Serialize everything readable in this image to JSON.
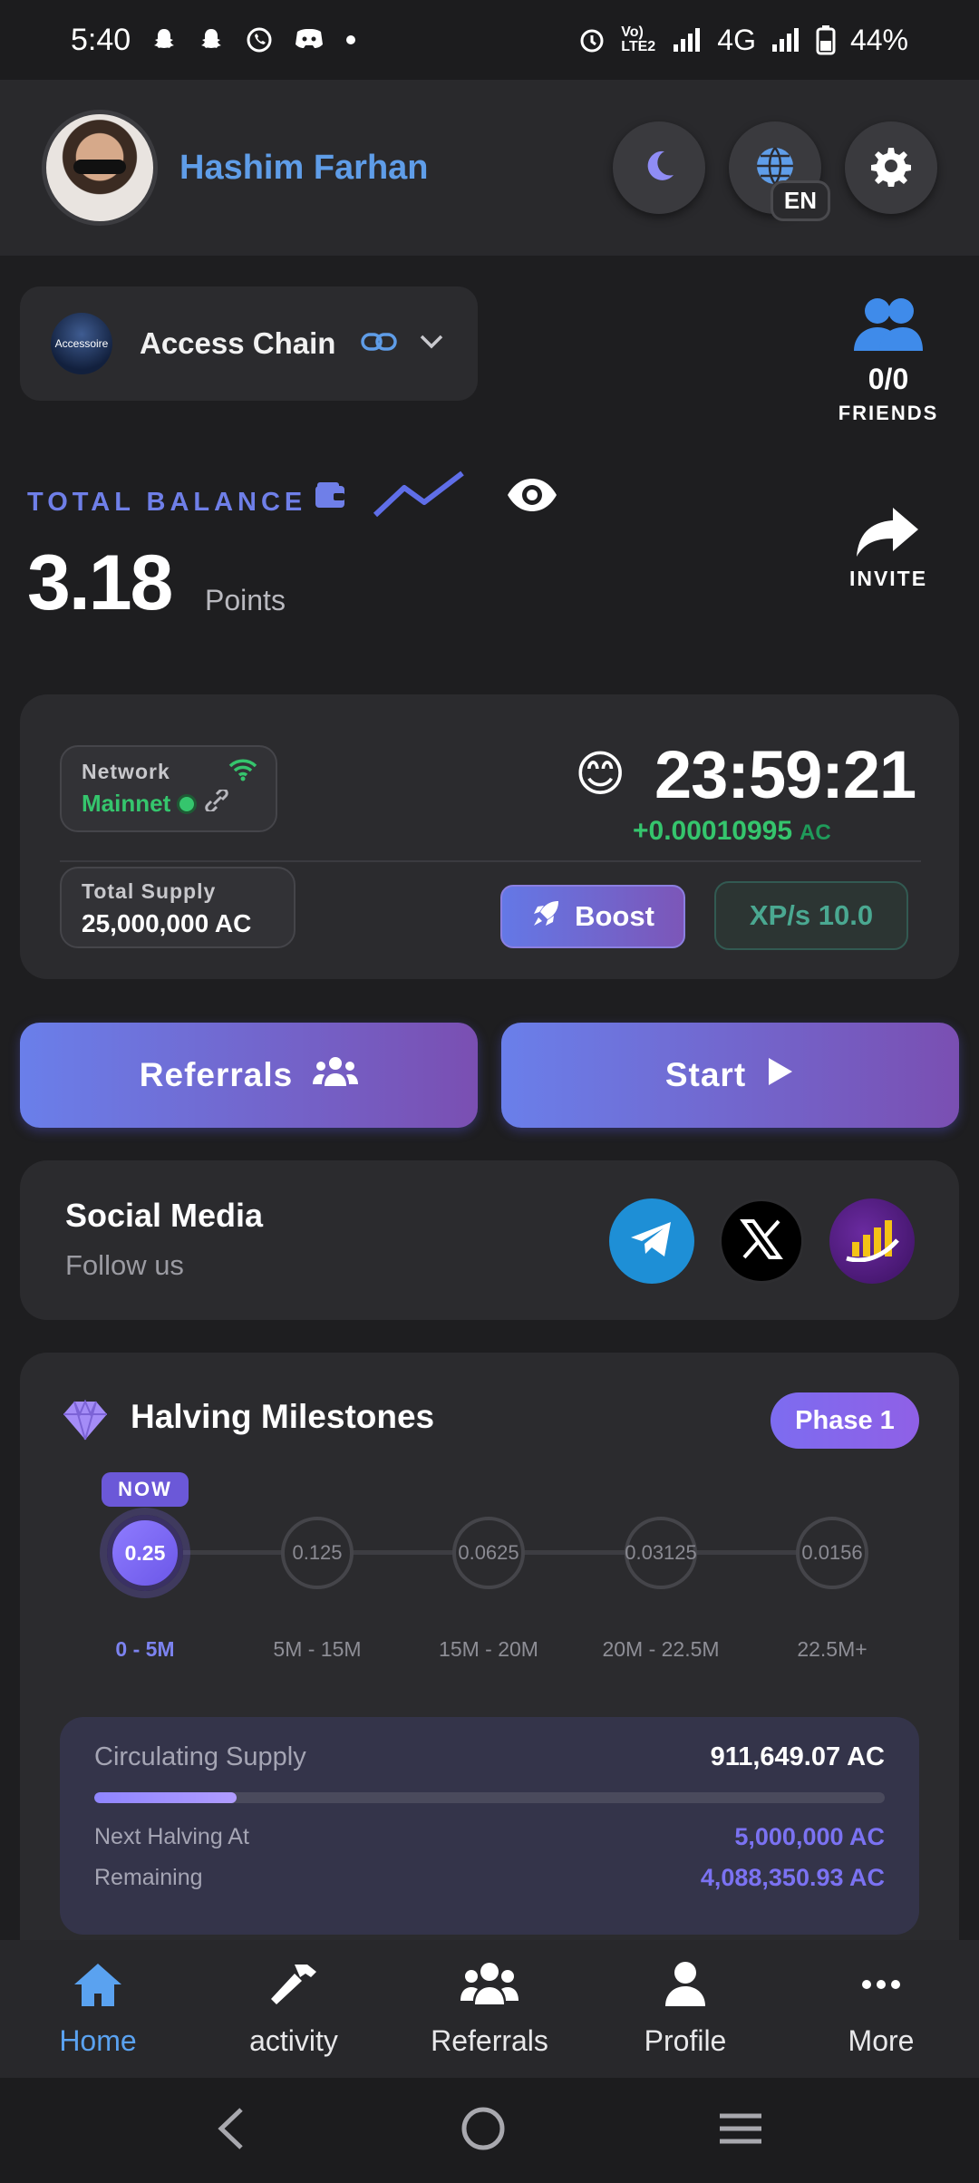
{
  "status_bar": {
    "time": "5:40",
    "battery": "44%",
    "network": "4G",
    "volte": "Vo) LTE2"
  },
  "header": {
    "user_name": "Hashim Farhan",
    "language": "EN",
    "icons": [
      "moon-icon",
      "globe-icon",
      "gear-icon"
    ]
  },
  "chain": {
    "name": "Access Chain",
    "logo_text": "Accessoire"
  },
  "friends": {
    "count": "0/0",
    "label": "FRIENDS"
  },
  "balance": {
    "label": "TOTAL BALANCE",
    "value": "3.18",
    "unit": "Points"
  },
  "invite": {
    "label": "INVITE"
  },
  "mining": {
    "network_title": "Network",
    "network_value": "Mainnet",
    "timer": "23:59:21",
    "emoji": "😊",
    "rate": "+0.00010995",
    "rate_unit": "AC",
    "supply_title": "Total Supply",
    "supply_value": "25,000,000 AC",
    "boost_label": "Boost",
    "xps_label": "XP/s 10.0"
  },
  "actions": {
    "referrals_label": "Referrals",
    "start_label": "Start"
  },
  "social": {
    "title": "Social Media",
    "subtitle": "Follow us",
    "links": [
      "telegram-icon",
      "x-icon",
      "chart-icon"
    ]
  },
  "milestones": {
    "title": "Halving Milestones",
    "phase": "Phase 1",
    "now_label": "NOW",
    "nodes": [
      {
        "value": "0.25",
        "range": "0 - 5M"
      },
      {
        "value": "0.125",
        "range": "5M - 15M"
      },
      {
        "value": "0.0625",
        "range": "15M - 20M"
      },
      {
        "value": "0.03125",
        "range": "20M - 22.5M"
      },
      {
        "value": "0.0156",
        "range": "22.5M+"
      }
    ],
    "circulating_label": "Circulating Supply",
    "circulating_value": "911,649.07 AC",
    "progress_fraction": 0.18,
    "next_halving_label": "Next Halving At",
    "next_halving_value": "5,000,000 AC",
    "remaining_label": "Remaining",
    "remaining_value": "4,088,350.93 AC"
  },
  "bottom_nav": [
    {
      "label": "Home",
      "icon": "home-icon"
    },
    {
      "label": "activity",
      "icon": "hammer-icon"
    },
    {
      "label": "Referrals",
      "icon": "users-icon"
    },
    {
      "label": "Profile",
      "icon": "person-icon"
    },
    {
      "label": "More",
      "icon": "more-icon"
    }
  ],
  "colors": {
    "accent_blue": "#5f9de8",
    "accent_purple": "#7b72f2",
    "green": "#35c56d"
  }
}
